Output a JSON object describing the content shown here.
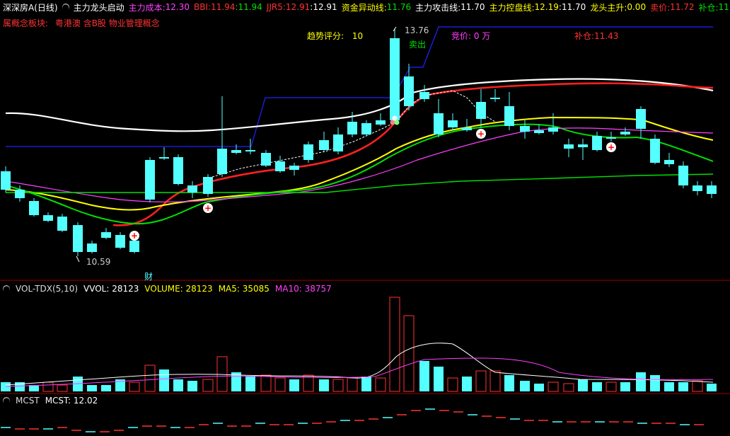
{
  "header": {
    "stock_name": "深深房A",
    "period": "(日线)",
    "indicator": "主力龙头启动",
    "cost_label": "主力成本:",
    "cost_value": "12.30",
    "bbi_label": "BBI:",
    "bbi_value": "11.94",
    "bbi_extra": ":11.94",
    "jjr_label": "JJR5:",
    "jjr_value": "12.91",
    "jjr_extra": ":12.91",
    "fund_label": "资金异动线:",
    "fund_value": "11.76",
    "attack_label": "主力攻击线:",
    "attack_value": "11.70",
    "control_label": "主力控盘线:",
    "control_value": "12.19",
    "control_extra": ":11.70",
    "dragon_label": "龙头主升:",
    "dragon_value": "0.00",
    "sell_label": "卖价:",
    "sell_value": "11.72",
    "fill_label": "补仓:",
    "fill_value": "11..."
  },
  "concept": {
    "label": "属概念板块:",
    "value": "粤港澳 含B股 物业管理概念"
  },
  "chart_labels": {
    "trend": "趋势评分:",
    "trend_value": "10",
    "bid": "竞价: 0 万",
    "bucang": "补仓:11.43",
    "high_label": "13.76",
    "low_label": "10.59",
    "sell_marker": "卖出",
    "cai": "财"
  },
  "vol_panel": {
    "name": "VOL-TDX(5,10)",
    "vvol": "VVOL: 28123",
    "volume": "VOLUME: 28123",
    "ma5": "MA5: 35085",
    "ma10": "MA10: 38757"
  },
  "mcst_panel": {
    "name": "MCST",
    "value": "MCST: 12.02"
  },
  "colors": {
    "up": "#ff3232",
    "down": "#54ffff",
    "white": "#ffffff",
    "yellow": "#ffff00",
    "green": "#00e000",
    "red": "#ff2020",
    "magenta": "#ff40ff",
    "blue": "#2222ff"
  }
}
